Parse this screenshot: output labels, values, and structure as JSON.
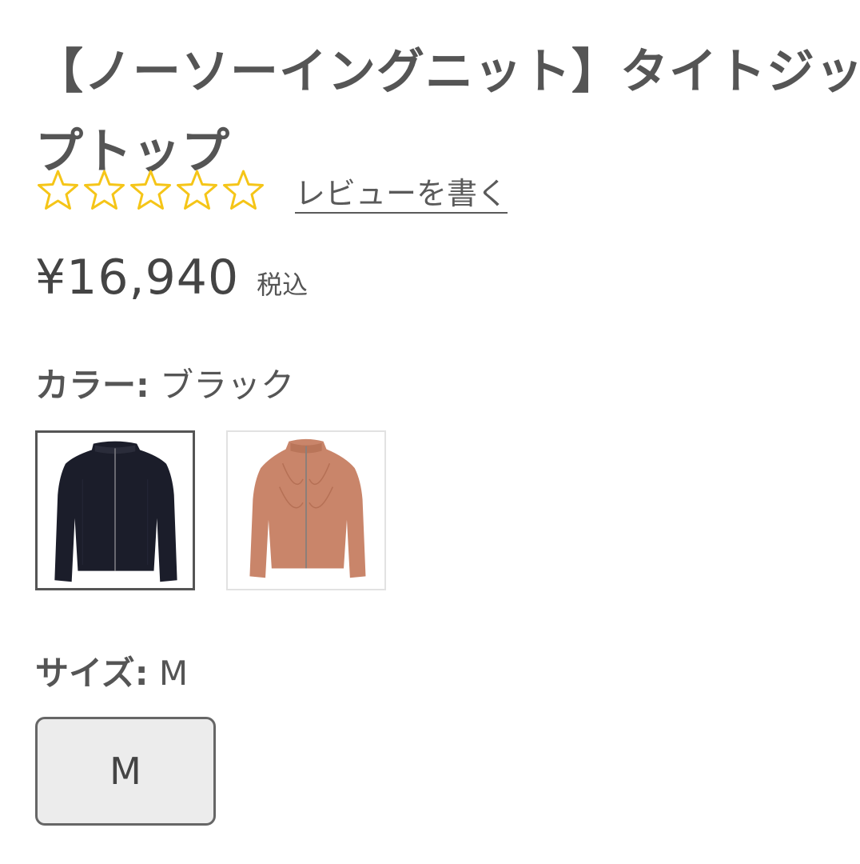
{
  "product": {
    "title_line1": "【ノーソーイングニット】タイトジッ",
    "title_line2": "プトップ",
    "rating": {
      "stars_filled": 0,
      "stars_total": 5,
      "star_color": "#f5c518",
      "review_link": "レビューを書く"
    },
    "price": "¥16,940",
    "tax_note": "税込"
  },
  "color": {
    "label": "カラー:",
    "selected_value": "ブラック",
    "swatches": [
      {
        "name": "ブラック",
        "garment_color": "#1b1d2a",
        "selected": true
      },
      {
        "name": "",
        "garment_color": "#c9856a",
        "selected": false
      }
    ]
  },
  "size": {
    "label": "サイズ:",
    "selected_value": "M",
    "options": [
      "M"
    ]
  }
}
